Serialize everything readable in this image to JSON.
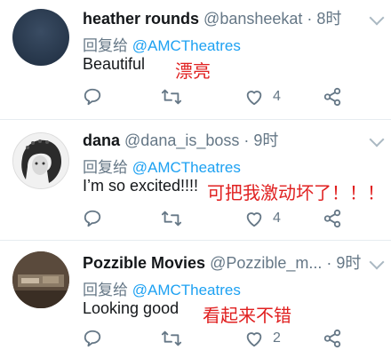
{
  "tweets": [
    {
      "name": "heather rounds",
      "handle": "@bansheekat",
      "time": "· 8时",
      "reply_prefix": "回复给 ",
      "reply_mention": "@AMCTheatres",
      "text": "Beautiful",
      "overlay": "漂亮",
      "likes": "4"
    },
    {
      "name": "dana",
      "handle": "@dana_is_boss",
      "time": "· 9时",
      "reply_prefix": "回复给 ",
      "reply_mention": "@AMCTheatres",
      "text": "I’m so excited!!!!",
      "overlay": "可把我激动坏了！！！",
      "likes": "4"
    },
    {
      "name": "Pozzible Movies",
      "handle": "@Pozzible_m...",
      "time": "· 9时",
      "reply_prefix": "回复给 ",
      "reply_mention": "@AMCTheatres",
      "text": "Looking good",
      "overlay": "看起来不错",
      "likes": "2"
    }
  ],
  "icons": {
    "reply": "reply-icon",
    "retweet": "retweet-icon",
    "like": "heart-icon",
    "share": "share-icon",
    "menu": "chevron-down-icon"
  },
  "colors": {
    "link": "#1da1f2",
    "muted": "#657786",
    "overlay": "#e02020"
  }
}
